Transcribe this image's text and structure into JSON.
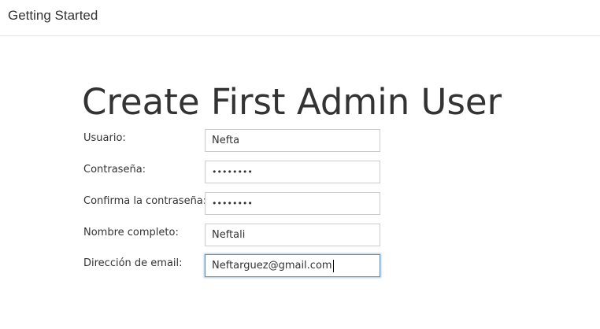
{
  "header": {
    "title": "Getting Started"
  },
  "page": {
    "heading": "Create First Admin User"
  },
  "form": {
    "username": {
      "label": "Usuario:",
      "value": "Nefta"
    },
    "password": {
      "label": "Contraseña:",
      "value": "••••••••"
    },
    "confirm_password": {
      "label": "Confirma la contraseña:",
      "value": "••••••••"
    },
    "full_name": {
      "label": "Nombre completo:",
      "value": "Neftali"
    },
    "email": {
      "label": "Dirección de email:",
      "value": "Neftarguez@gmail.com"
    }
  },
  "colors": {
    "focus_border": "#6b8fb0",
    "input_border": "#cccccc",
    "text": "#333333"
  }
}
